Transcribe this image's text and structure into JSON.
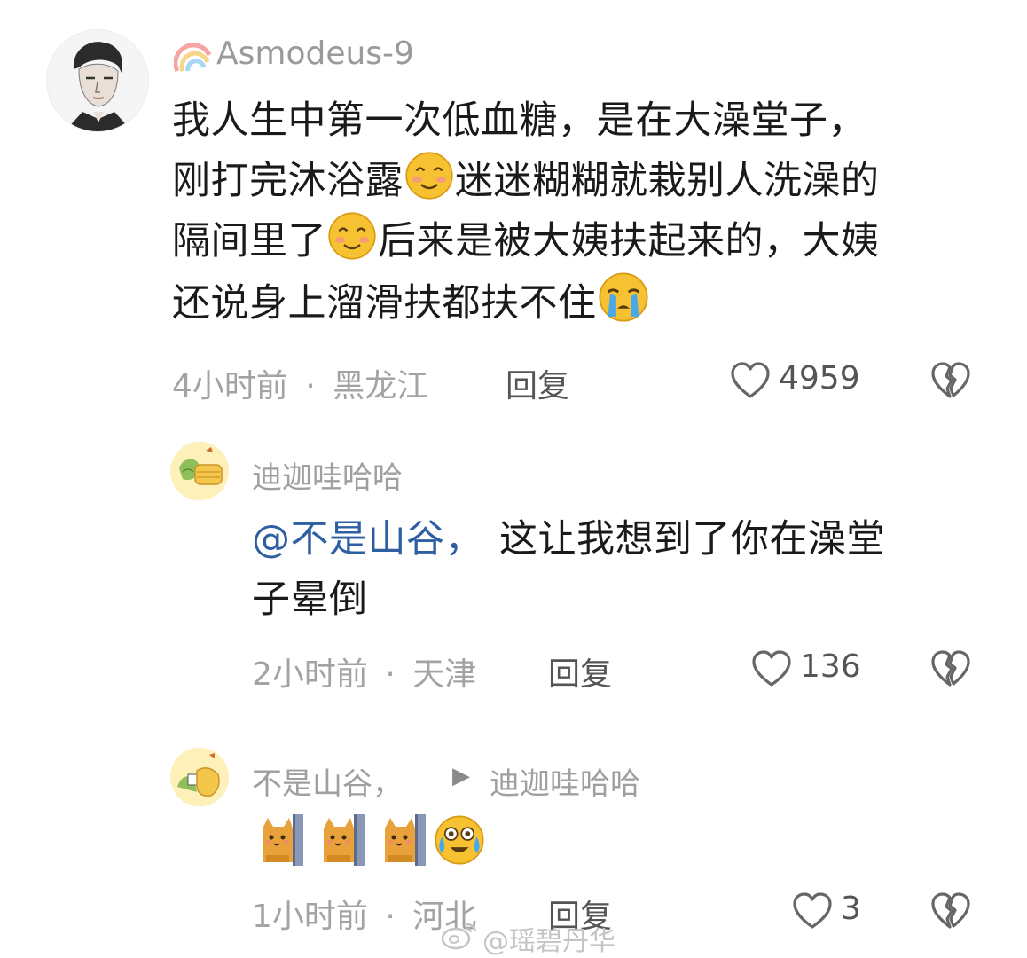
{
  "comments": [
    {
      "username": "Asmodeus-9",
      "text_lines": [
        {
          "a": "我人生中第一次低血糖，是在大澡堂子，"
        },
        {
          "a": "刚打完沐浴露",
          "b": "迷迷糊糊就栽别人洗澡的"
        },
        {
          "a": "隔间里了",
          "b": "后来是被大姨扶起来的，大姨"
        },
        {
          "a": "还说身上溜滑扶都扶不住"
        }
      ],
      "emojis": [
        "blush-emoji",
        "blush-emoji",
        "crying-emoji"
      ],
      "time": "4小时前",
      "separator": "·",
      "location": "黑龙江",
      "reply_label": "回复",
      "likes": "4959"
    },
    {
      "username": "迪迦哇哈哈",
      "mention": "@不是山谷，",
      "text_lines": [
        {
          "a": "这让我想到了你在澡堂"
        },
        {
          "a": "子晕倒"
        }
      ],
      "time": "2小时前",
      "separator": "·",
      "location": "天津",
      "reply_label": "回复",
      "likes": "136"
    },
    {
      "username": "不是山谷，",
      "reply_to_arrow": "▶",
      "reply_to": "迪迦哇哈哈",
      "emojis": [
        "cat-peek-emoji",
        "cat-peek-emoji",
        "cat-peek-emoji",
        "tearful-laugh-emoji"
      ],
      "time": "1小时前",
      "separator": "·",
      "location": "河北",
      "reply_label": "回复",
      "likes": "3"
    }
  ],
  "watermark": "@瑶碧丹华",
  "colors": {
    "background": "#ffffff",
    "text": "#1a1a1a",
    "meta": "#a3a3a3",
    "mention": "#2f5fa3",
    "emoji_yellow": "#f7c232"
  }
}
